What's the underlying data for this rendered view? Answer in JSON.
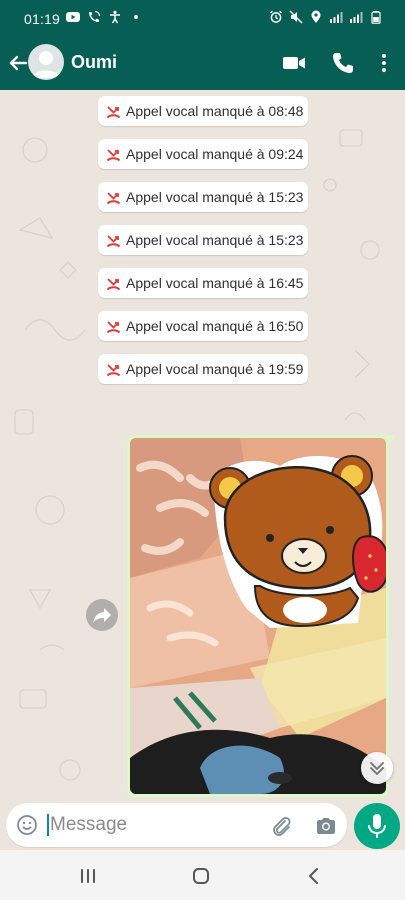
{
  "status_bar": {
    "time": "01:19"
  },
  "header": {
    "contact_name": "Oumi"
  },
  "missed_calls": [
    {
      "label": "Appel vocal manqué à 08:48"
    },
    {
      "label": "Appel vocal manqué à 09:24"
    },
    {
      "label": "Appel vocal manqué à 15:23"
    },
    {
      "label": "Appel vocal manqué à 15:23"
    },
    {
      "label": "Appel vocal manqué à 16:45"
    },
    {
      "label": "Appel vocal manqué à 16:50"
    },
    {
      "label": "Appel vocal manqué à 19:59"
    }
  ],
  "input": {
    "placeholder": "Message"
  },
  "icons": {
    "status": [
      "youtube-icon",
      "wifi-call-icon",
      "accessibility-icon",
      "dot-icon",
      "alarm-icon",
      "mute-icon",
      "location-icon",
      "signal-icon",
      "battery-icon"
    ],
    "header": [
      "back-arrow-icon",
      "avatar-icon",
      "video-call-icon",
      "phone-icon",
      "more-vertical-icon"
    ],
    "call": "missed-call-icon",
    "input": [
      "emoji-icon",
      "attach-icon",
      "camera-icon",
      "mic-icon"
    ],
    "nav": [
      "recents-icon",
      "home-icon",
      "back-icon"
    ]
  },
  "colors": {
    "header": "#075e54",
    "chat_background": "#ece5dd",
    "outgoing_bubble": "#dcf8c6",
    "missed_call": "#e53935",
    "mic_button": "#00a884"
  }
}
